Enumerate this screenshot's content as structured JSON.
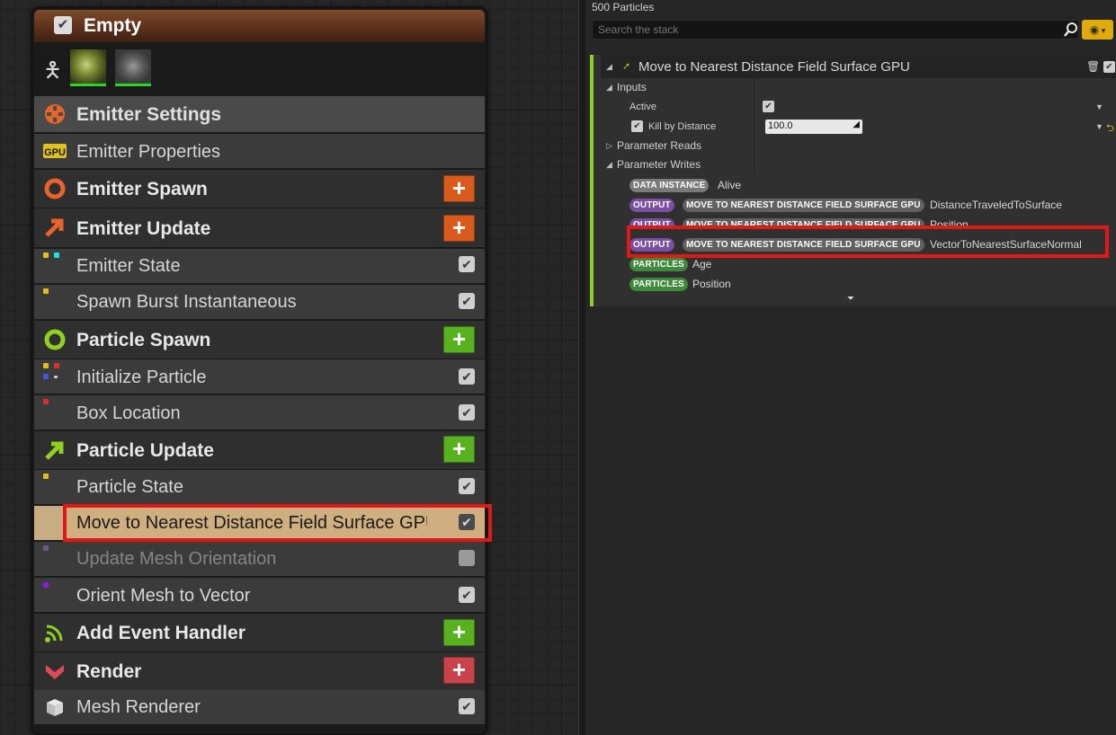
{
  "node": {
    "title": "Empty",
    "sections": {
      "emitter_settings": "Emitter Settings",
      "emitter_properties": "Emitter Properties",
      "emitter_spawn": "Emitter Spawn",
      "emitter_update": "Emitter Update",
      "emitter_state": "Emitter State",
      "spawn_burst": "Spawn Burst Instantaneous",
      "particle_spawn": "Particle Spawn",
      "initialize_particle": "Initialize Particle",
      "box_location": "Box Location",
      "particle_update": "Particle Update",
      "particle_state": "Particle State",
      "move_to_nearest": "Move to Nearest Distance Field Surface GPU",
      "update_mesh_orientation": "Update Mesh Orientation",
      "orient_mesh": "Orient Mesh to Vector",
      "add_event_handler": "Add Event Handler",
      "render": "Render",
      "mesh_renderer": "Mesh Renderer"
    },
    "gpu_badge": "GPU",
    "add_symbol": "+"
  },
  "panel": {
    "particle_count": "500 Particles",
    "search_placeholder": "Search the stack",
    "module": {
      "title": "Move to Nearest Distance Field Surface GPU",
      "inputs_label": "Inputs",
      "active_label": "Active",
      "kill_by_distance_label": "Kill by Distance",
      "kill_by_distance_value": "100.0",
      "parameter_reads_label": "Parameter Reads",
      "parameter_writes_label": "Parameter Writes",
      "writes": [
        {
          "tag1": "DATA INSTANCE",
          "tag2": "",
          "name": "Alive"
        },
        {
          "tag1": "OUTPUT",
          "tag2": "MOVE TO NEAREST DISTANCE FIELD SURFACE GPU",
          "name": "DistanceTraveledToSurface"
        },
        {
          "tag1": "OUTPUT",
          "tag2": "MOVE TO NEAREST DISTANCE FIELD SURFACE GPU",
          "name": "Position"
        },
        {
          "tag1": "OUTPUT",
          "tag2": "MOVE TO NEAREST DISTANCE FIELD SURFACE GPU",
          "name": "VectorToNearestSurfaceNormal"
        },
        {
          "tag1": "PARTICLES",
          "tag2": "",
          "name": "Age"
        },
        {
          "tag1": "PARTICLES",
          "tag2": "",
          "name": "Position"
        }
      ]
    }
  },
  "colors": {
    "accent_orange": "#d85a1c",
    "accent_green": "#58b220",
    "accent_red": "#c8444a",
    "selected_row": "#c8ac84",
    "highlight_box": "#e01818",
    "module_bar": "#8bcf2a"
  }
}
